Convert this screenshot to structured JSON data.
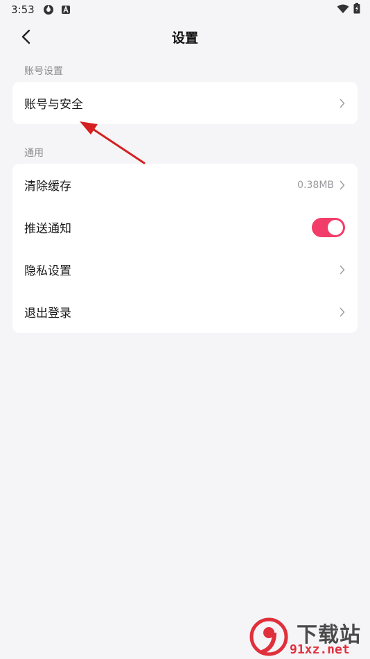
{
  "status_bar": {
    "time": "3:53"
  },
  "nav": {
    "title": "设置"
  },
  "account_section": {
    "label": "账号设置",
    "items": [
      {
        "label": "账号与安全"
      }
    ]
  },
  "general_section": {
    "label": "通用",
    "clear_cache": {
      "label": "清除缓存",
      "value": "0.38MB"
    },
    "push_notification": {
      "label": "推送通知",
      "enabled": true
    },
    "privacy": {
      "label": "隐私设置"
    },
    "logout": {
      "label": "退出登录"
    }
  },
  "watermark": {
    "top": "下载站",
    "bottom": "91xz.net"
  },
  "colors": {
    "accent": "#f23c6a",
    "background": "#f5f5f8",
    "annotation": "#d42020"
  }
}
